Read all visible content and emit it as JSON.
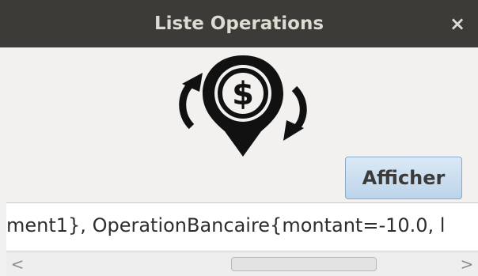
{
  "window": {
    "title": "Liste Operations",
    "close_glyph": "×"
  },
  "logo": {
    "icon": "dollar-exchange-pin-icon",
    "symbol": "$"
  },
  "actions": {
    "afficher_label": "Afficher"
  },
  "output": {
    "text": "ment1}, OperationBancaire{montant=-10.0, l"
  },
  "scrollbar": {
    "left_arrow": "<",
    "right_arrow": ">"
  },
  "colors": {
    "titlebar": "#3c3b37",
    "title_text": "#dfdbd2",
    "window_bg": "#f2f1f0",
    "button_bg": "#c8dbee",
    "button_border": "#8aa9c8"
  }
}
